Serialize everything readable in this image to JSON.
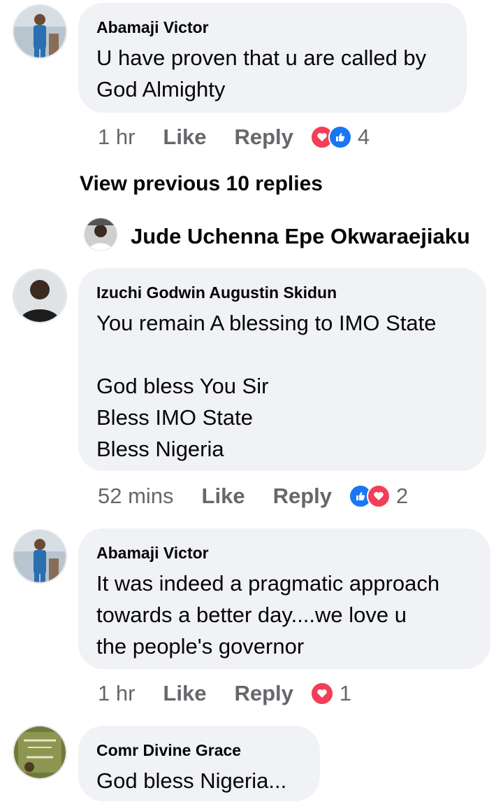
{
  "comments": [
    {
      "author": "Abamaji Victor",
      "text": "U have proven that u are called by\nGod Almighty",
      "time": "1 hr",
      "like_label": "Like",
      "reply_label": "Reply",
      "reactions": [
        "love",
        "like"
      ],
      "reaction_count": "4"
    },
    {
      "author": "Izuchi Godwin Augustin Skidun",
      "text": "You remain A blessing to IMO State\n\nGod bless You Sir\nBless IMO State\nBless Nigeria",
      "time": "52 mins",
      "like_label": "Like",
      "reply_label": "Reply",
      "reactions": [
        "like",
        "love"
      ],
      "reaction_count": "2"
    },
    {
      "author": "Abamaji Victor",
      "text": "It was indeed a pragmatic approach\ntowards a better day....we love u\nthe people's governor",
      "time": "1 hr",
      "like_label": "Like",
      "reply_label": "Reply",
      "reactions": [
        "love"
      ],
      "reaction_count": "1"
    },
    {
      "author": "Comr Divine Grace",
      "text": "God bless Nigeria..."
    }
  ],
  "view_previous": "View previous 10 replies",
  "reply_thread": {
    "author": "Jude Uchenna Epe Okwaraejiaku"
  },
  "colors": {
    "bubble": "#f0f2f5",
    "secondary_text": "#65676b",
    "love": "#f33e58",
    "like": "#1877f2"
  }
}
